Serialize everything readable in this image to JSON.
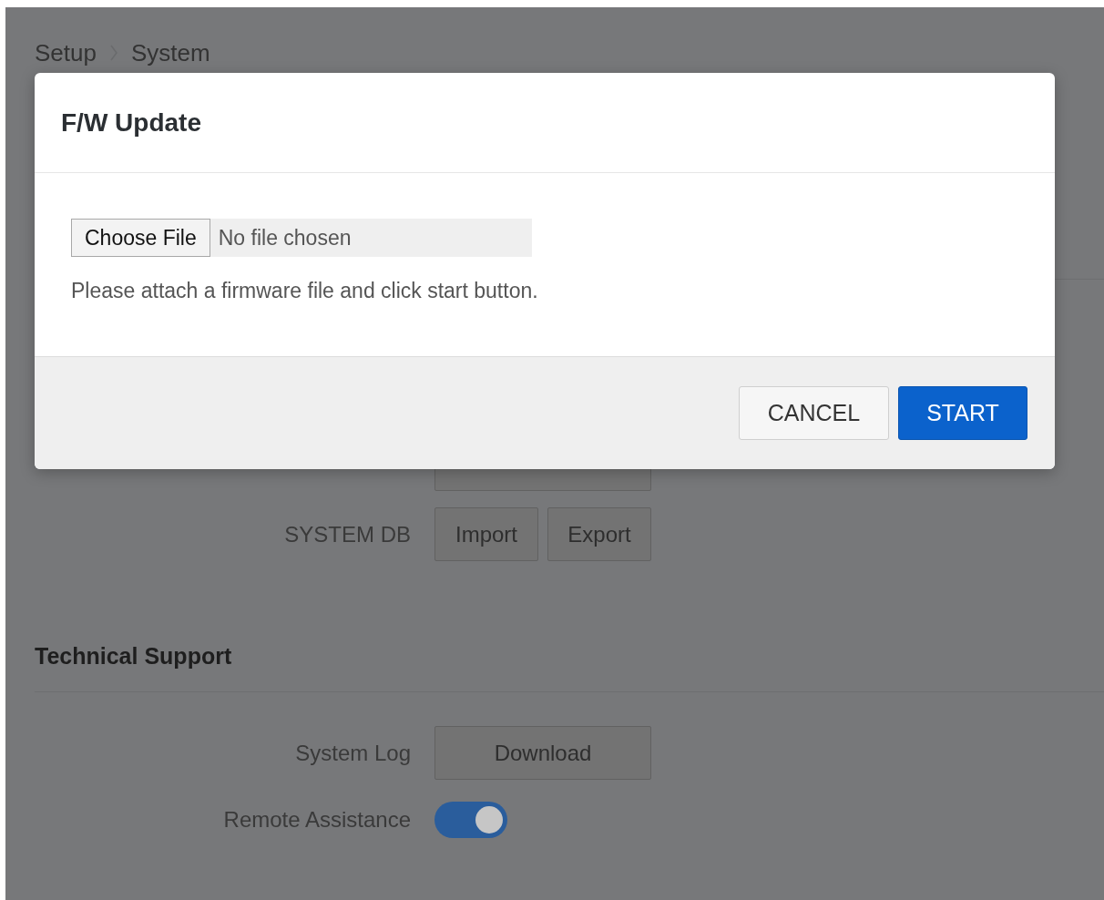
{
  "breadcrumb": [
    "Setup",
    "System"
  ],
  "system_db": {
    "label": "SYSTEM DB",
    "buttons": [
      "Import",
      "Export"
    ]
  },
  "technical_support": {
    "title": "Technical Support",
    "rows": [
      {
        "kind": "button",
        "label": "System Log",
        "button": "Download"
      },
      {
        "kind": "toggle",
        "label": "Remote Assistance",
        "on": true
      }
    ]
  },
  "modal": {
    "title": "F/W Update",
    "file_input": {
      "button": "Choose File",
      "status": "No file chosen"
    },
    "hint": "Please attach a firmware file and click start button.",
    "buttons": [
      {
        "label": "CANCEL",
        "kind": "secondary"
      },
      {
        "label": "START",
        "kind": "primary"
      }
    ]
  }
}
